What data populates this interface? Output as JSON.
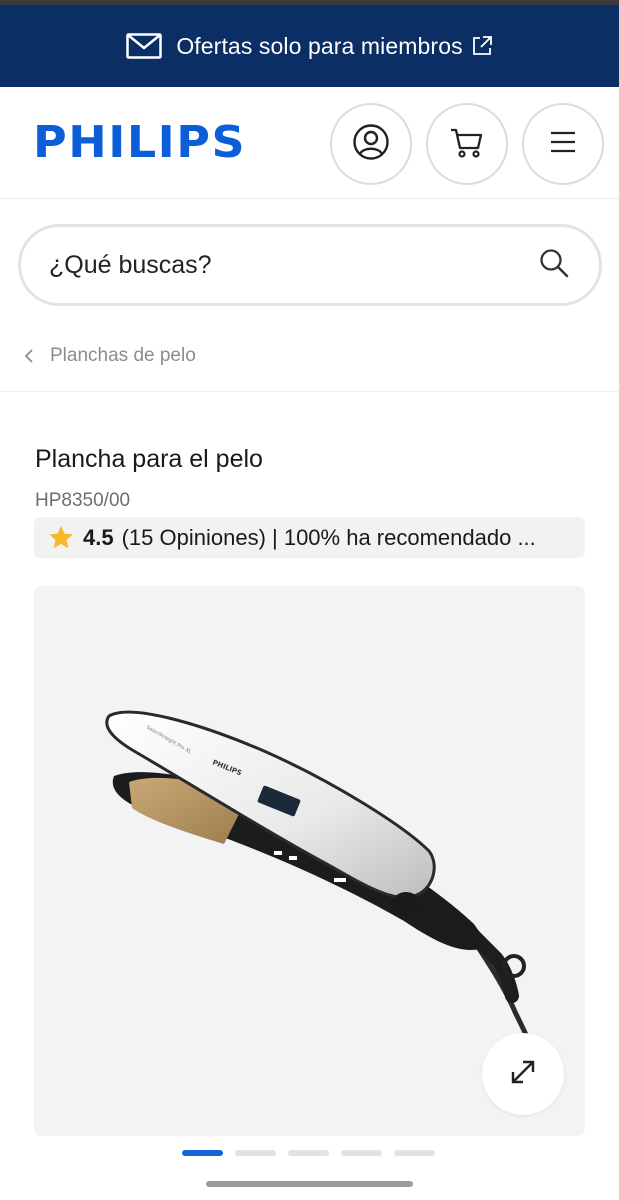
{
  "banner": {
    "text": "Ofertas solo para miembros",
    "icon": "mail-icon",
    "ext_icon": "external-link-icon"
  },
  "header": {
    "logo": "PHILIPS",
    "account_icon": "user-icon",
    "cart_icon": "cart-icon",
    "menu_icon": "hamburger-icon"
  },
  "search": {
    "placeholder": "¿Qué buscas?",
    "icon": "search-icon"
  },
  "breadcrumb": {
    "label": "Planchas de pelo",
    "icon": "chevron-left-icon"
  },
  "product": {
    "title": "Plancha para el pelo",
    "sku": "HP8350/00",
    "rating_score": "4.5",
    "rating_text": "(15 Opiniones) | 100% ha recomendado ...",
    "image_alt": "Plancha para el pelo Philips",
    "image_brand": "PHILIPS",
    "image_model": "SalonStraight Pro XL"
  },
  "gallery": {
    "expand_icon": "expand-icon",
    "pages": 5,
    "active_page": 1
  },
  "colors": {
    "banner": "#0b2e64",
    "brand": "#0b5ed7",
    "active_dot": "#1565d8",
    "star": "#f5b92a"
  }
}
